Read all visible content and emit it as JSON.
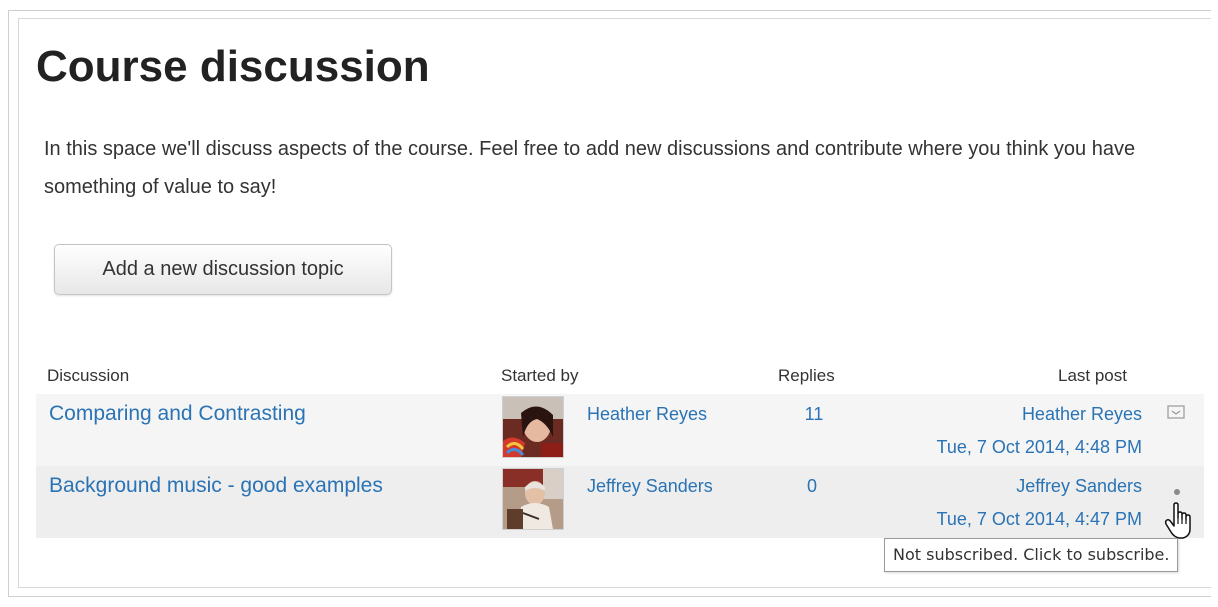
{
  "page": {
    "title": "Course discussion",
    "intro": "In this space we'll discuss aspects of the course. Feel free to add new discussions and contribute where you think you have something of value to say!"
  },
  "toolbar": {
    "add_label": "Add a new discussion topic"
  },
  "table": {
    "headers": {
      "discussion": "Discussion",
      "started_by": "Started by",
      "replies": "Replies",
      "last_post": "Last post"
    },
    "rows": [
      {
        "discussion": "Comparing and Contrasting",
        "started_by": "Heather Reyes",
        "replies": "11",
        "last_post_author": "Heather Reyes",
        "last_post_date": "Tue, 7 Oct 2014, 4:48 PM",
        "subscription_icon": "envelope-icon"
      },
      {
        "discussion": "Background music - good examples",
        "started_by": "Jeffrey Sanders",
        "replies": "0",
        "last_post_author": "Jeffrey Sanders",
        "last_post_date": "Tue, 7 Oct 2014, 4:47 PM",
        "subscription_icon": "dot-icon"
      }
    ]
  },
  "tooltip": {
    "text": "Not subscribed. Click to subscribe."
  },
  "colors": {
    "link": "#2a73b5",
    "row_odd": "#f5f5f5",
    "row_even": "#eeeeee"
  }
}
